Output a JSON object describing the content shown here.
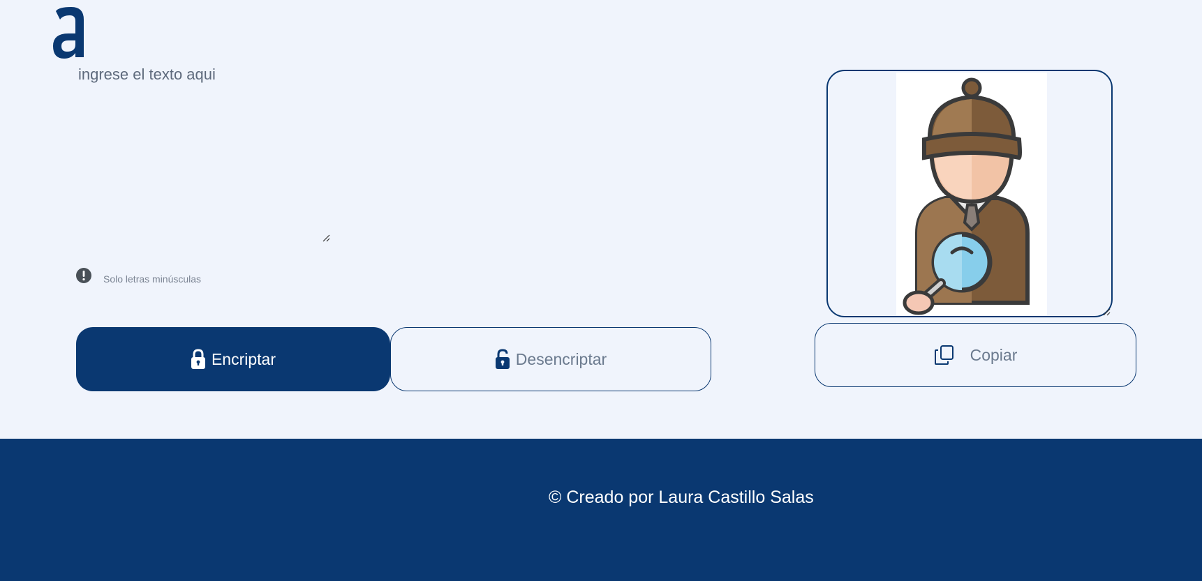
{
  "app": {
    "logo_icon": "alura-a-logo",
    "brand_color": "#0a3871",
    "background_color": "#f0f4fc"
  },
  "input": {
    "placeholder": "ingrese el texto aqui",
    "value": ""
  },
  "hint": {
    "icon": "exclamation-circle-icon",
    "text": "Solo letras minúsculas"
  },
  "buttons": {
    "encrypt": {
      "label": "Encriptar",
      "icon": "lock-icon"
    },
    "decrypt": {
      "label": "Desencriptar",
      "icon": "unlock-icon"
    },
    "copy": {
      "label": "Copiar",
      "icon": "copy-icon"
    }
  },
  "output": {
    "image": "detective-illustration"
  },
  "footer": {
    "text": "© Creado por Laura Castillo Salas"
  }
}
